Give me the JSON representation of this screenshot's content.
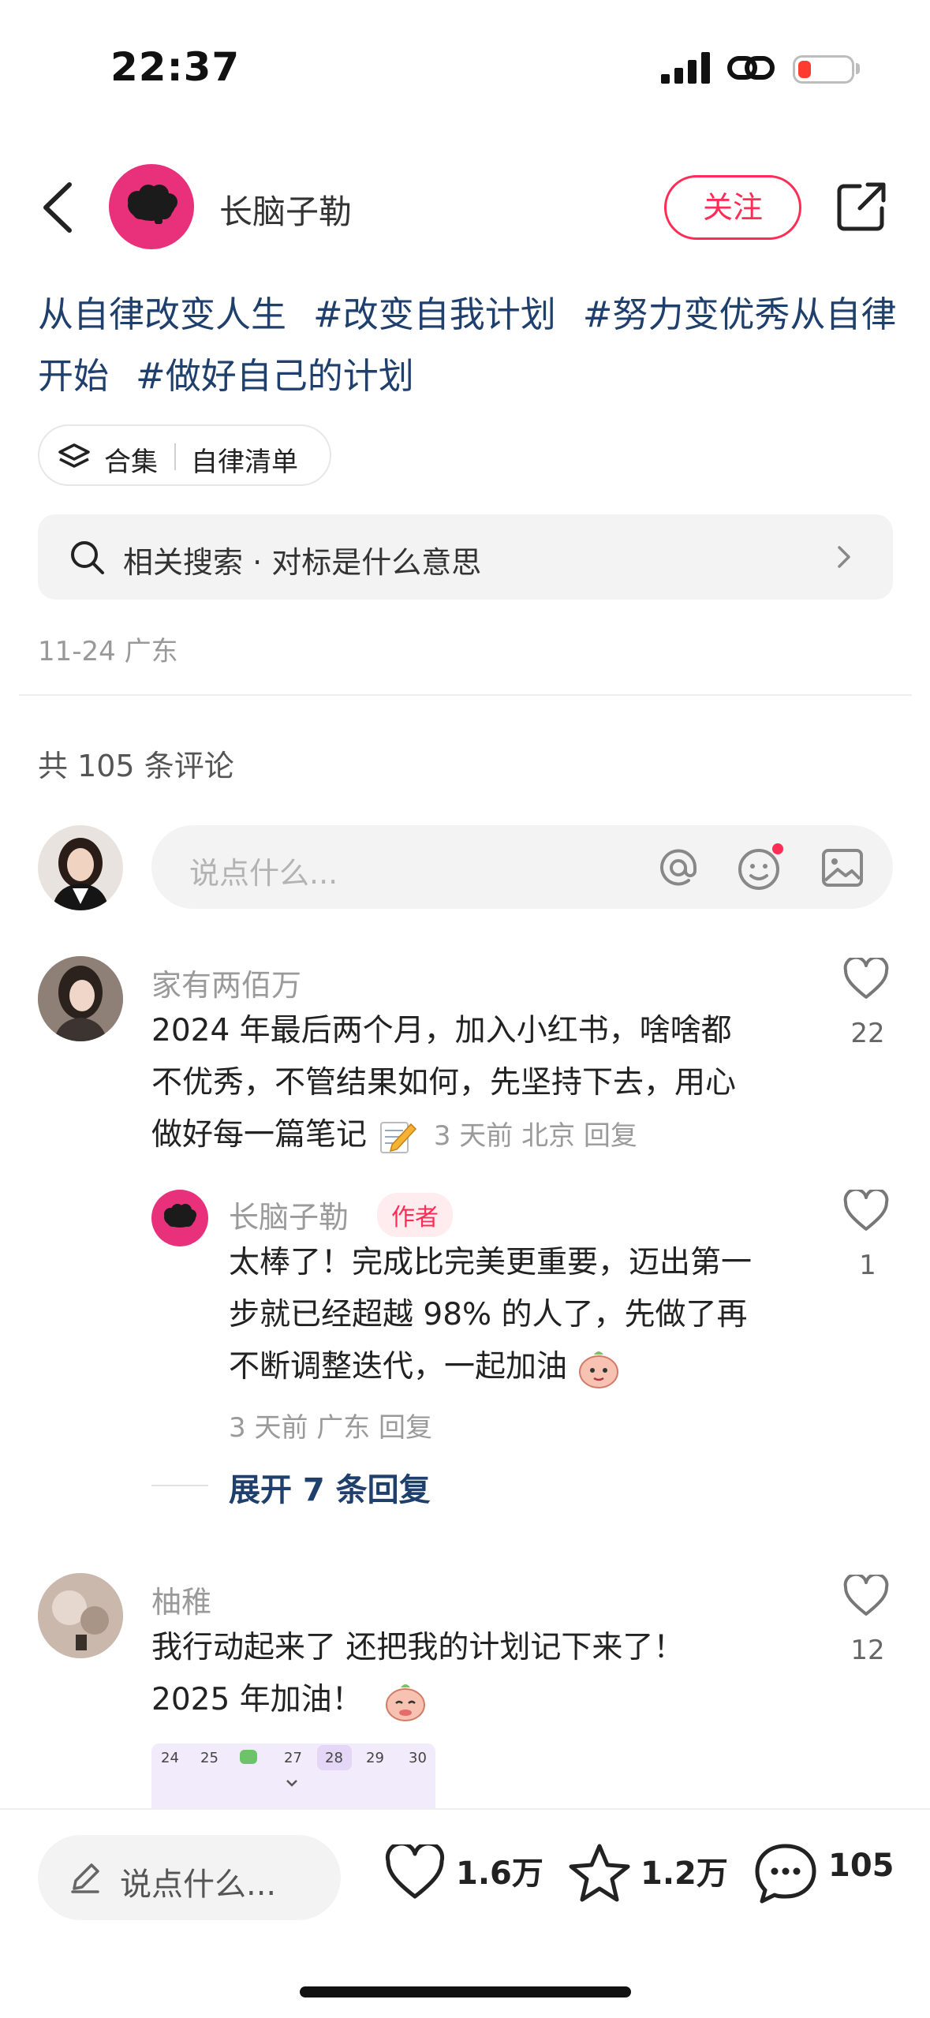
{
  "status_bar": {
    "time": "22:37"
  },
  "header": {
    "author_name": "长脑子勒",
    "follow_label": "关注"
  },
  "post": {
    "hashtags": [
      "从自律改变人生",
      "#改变自我计划",
      "#努力变优秀从自律开始",
      "#做好自己的计划"
    ],
    "collection": {
      "label": "合集",
      "name": "自律清单"
    },
    "related_search": "相关搜索 · 对标是什么意思",
    "date_location": "11-24 广东"
  },
  "comments_section": {
    "count_label": "共 105 条评论",
    "input_placeholder": "说点什么...",
    "comments": [
      {
        "username": "家有两佰万",
        "text_line1": "2024 年最后两个月，加入小红书，啥啥都",
        "text_line2": "不优秀，不管结果如何，先坚持下去，用心",
        "text_line3": "做好每一篇笔记",
        "meta": "3 天前  北京  回复",
        "likes": "22"
      },
      {
        "username": "长脑子勒",
        "author_tag": "作者",
        "text_line1": "太棒了！完成比完美更重要，迈出第一",
        "text_line2": "步就已经超越 98% 的人了，先做了再",
        "text_line3": "不断调整迭代，一起加油",
        "meta": "3 天前  广东  回复",
        "likes": "1"
      },
      {
        "username": "柚稚",
        "text_line1": "我行动起来了 还把我的计划记下来了！",
        "text_line2": "2025 年加油！",
        "likes": "12",
        "calendar_days": [
          "24",
          "25",
          "",
          "27",
          "28",
          "29",
          "30"
        ]
      }
    ],
    "expand_label": "展开 7 条回复"
  },
  "bottom_bar": {
    "input_placeholder": "说点什么...",
    "likes": "1.6万",
    "favorites": "1.2万",
    "comments": "105"
  },
  "colors": {
    "accent": "#ff2d55",
    "link": "#1f3f6c",
    "avatar_pink": "#e8317a"
  }
}
